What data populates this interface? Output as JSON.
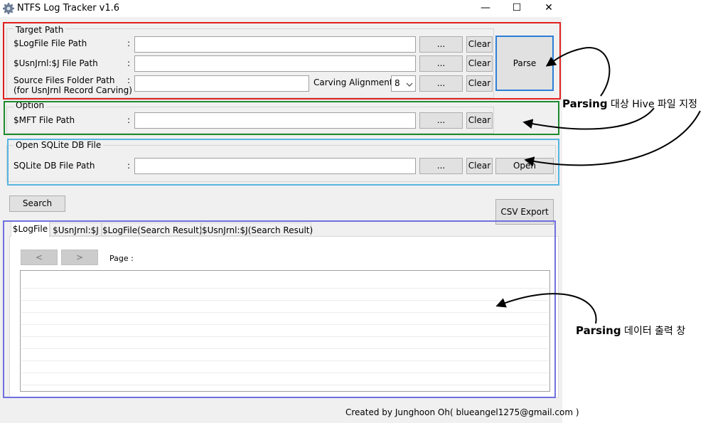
{
  "window": {
    "title": "NTFS Log Tracker v1.6",
    "controls": {
      "minimize": "—",
      "maximize": "☐",
      "close": "✕"
    }
  },
  "target_path": {
    "legend": "Target Path",
    "logfile_label": "$LogFile File Path",
    "usnjrnl_label": "$UsnJrnl:$J File Path",
    "source_label_line1": "Source Files Folder Path",
    "source_label_line2": "(for UsnJrnl Record Carving)",
    "colon": ":",
    "carving_label": "Carving Alignment :",
    "carving_value": "8",
    "browse": "...",
    "clear": "Clear",
    "parse": "Parse"
  },
  "option": {
    "legend": "Option",
    "mft_label": "$MFT File Path",
    "colon": ":",
    "browse": "...",
    "clear": "Clear"
  },
  "sqlite": {
    "legend": "Open SQLite DB File",
    "db_label": "SQLite DB File Path",
    "colon": ":",
    "browse": "...",
    "clear": "Clear",
    "open": "Open"
  },
  "actions": {
    "search": "Search",
    "csv_export": "CSV Export"
  },
  "tabs": [
    "$LogFile",
    "$UsnJrnl:$J",
    "$LogFile(Search Result)",
    "$UsnJrnl:$J(Search Result)"
  ],
  "pager": {
    "prev": "<",
    "next": ">",
    "page_label": "Page :"
  },
  "footer": "Created by Junghoon Oh( blueangel1275@gmail.com )",
  "annotations": {
    "parse_bold": "Parsing",
    "parse_rest": " 대상 Hive 파일 지정",
    "output_bold": "Parsing",
    "output_rest": " 데이터 출력 창"
  },
  "colors": {
    "target_box": "#e02020",
    "option_box": "#1e8a2e",
    "sqlite_box": "#57b5e0",
    "output_box": "#7070e0",
    "parse_border": "#2b7ed6"
  }
}
